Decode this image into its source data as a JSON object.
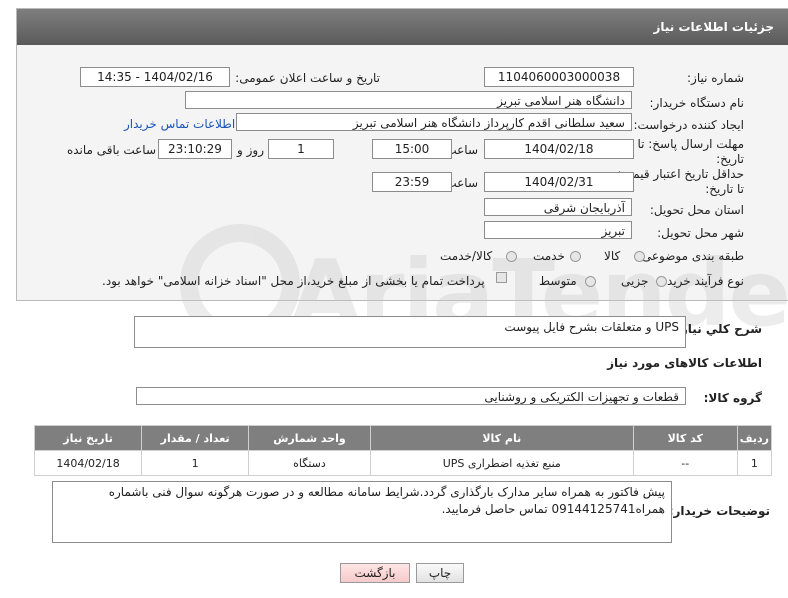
{
  "panel": {
    "title": "جزئیات اطلاعات نیاز"
  },
  "fields": {
    "need_number_label": "شماره نیاز:",
    "need_number": "1104060003000038",
    "announce_label": "تاریخ و ساعت اعلان عمومی:",
    "announce_value": "1404/02/16 - 14:35",
    "buyer_org_label": "نام دستگاه خریدار:",
    "buyer_org": "دانشگاه هنر اسلامی تبریز",
    "creator_label": "ایجاد کننده درخواست:",
    "creator": "سعید سلطانی اقدم کارپرداز دانشگاه هنر اسلامی تبریز",
    "contact_link": "اطلاعات تماس خریدار",
    "deadline_label_1": "مهلت ارسال پاسخ: تا",
    "deadline_label_2": "تاریخ:",
    "deadline_date": "1404/02/18",
    "hour_label": "ساعت",
    "deadline_time": "15:00",
    "days_value": "1",
    "days_label": "روز و",
    "remaining_time": "23:10:29",
    "remaining_label": "ساعت باقی مانده",
    "validity_label_1": "حداقل تاریخ اعتبار قیمت:",
    "validity_label_2": "تا تاریخ:",
    "validity_date": "1404/02/31",
    "validity_hour_label": "ساعت",
    "validity_time": "23:59",
    "province_label": "استان محل تحویل:",
    "province": "آذربایجان شرقی",
    "city_label": "شهر محل تحویل:",
    "city": "تبریز",
    "category_label": "طبقه بندی موضوعی:",
    "category_options": [
      "کالا",
      "خدمت",
      "کالا/خدمت"
    ],
    "process_label": "نوع فرآیند خرید :",
    "process_options": [
      "جزیی",
      "متوسط"
    ],
    "payment_note": "پرداخت تمام یا بخشی از مبلغ خرید،از محل \"اسناد خزانه اسلامی\" خواهد بود."
  },
  "description": {
    "label": "شرح کلي نياز:",
    "value": "UPS و متعلقات بشرح فایل پیوست"
  },
  "goods_section": {
    "title": "اطلاعات کالاهای مورد نیاز"
  },
  "goods_group": {
    "label": "گروه کالا:",
    "value": "قطعات و تجهیزات الکتریکی و روشنایی"
  },
  "table": {
    "headers": [
      "ردیف",
      "کد کالا",
      "نام کالا",
      "واحد شمارش",
      "تعداد / مقدار",
      "تاریخ نیاز"
    ],
    "rows": [
      [
        "1",
        "--",
        "منبع تغذیه اضطراری UPS",
        "دستگاه",
        "1",
        "1404/02/18"
      ]
    ]
  },
  "buyer_notes": {
    "label": "توضیحات خریدار:",
    "value": "پیش فاکتور به همراه سایر مدارک بارگذاری گردد.شرایط سامانه مطالعه و در صورت هرگونه سوال فنی باشماره همراه09144125741 تماس حاصل فرمایید."
  },
  "buttons": {
    "print": "چاپ",
    "back": "بازگشت"
  },
  "watermark_text": "AriaTender.net"
}
